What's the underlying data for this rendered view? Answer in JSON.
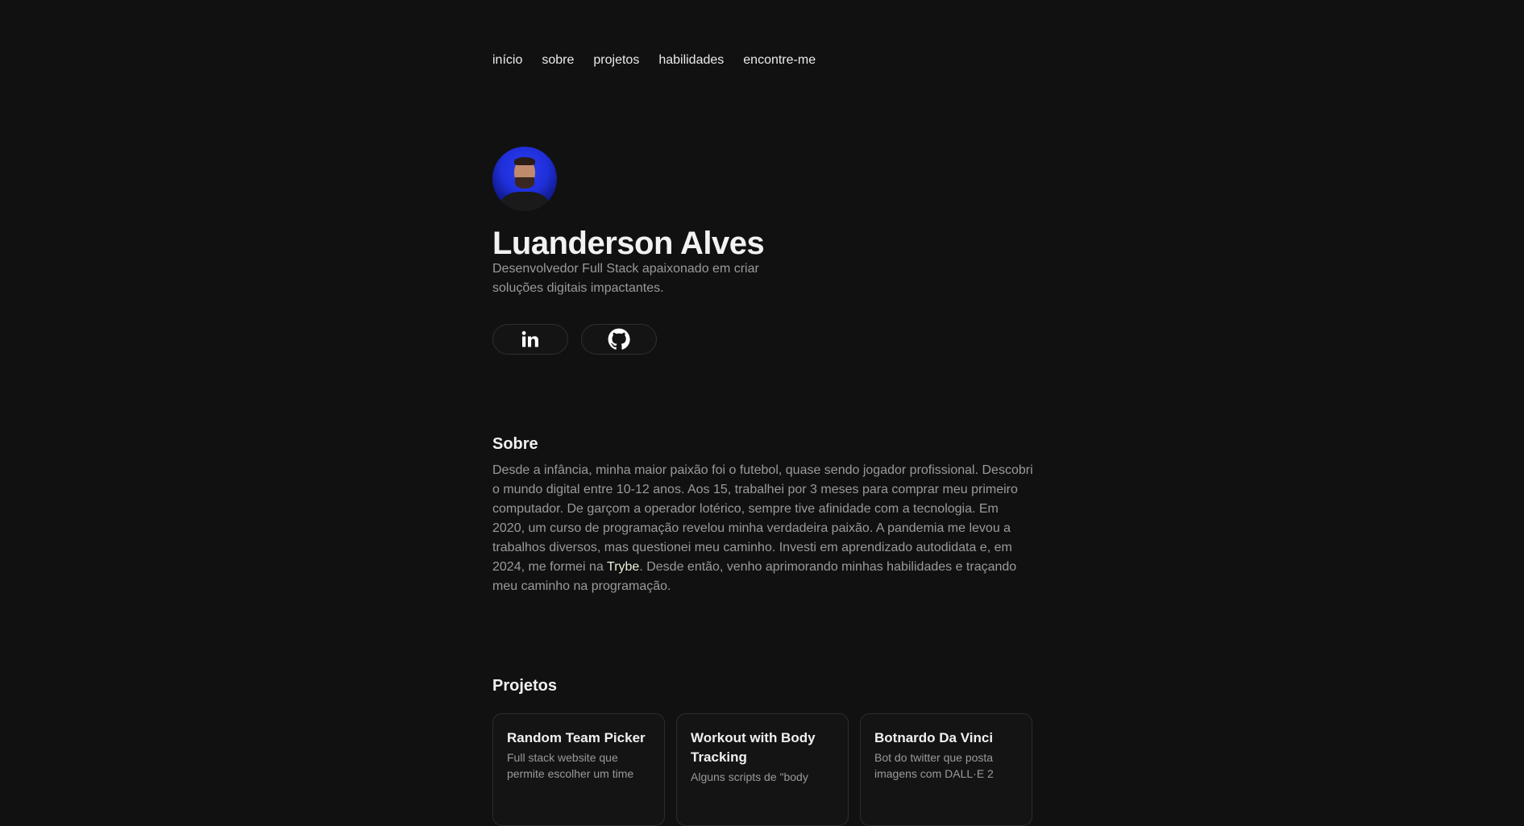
{
  "nav": {
    "items": [
      "início",
      "sobre",
      "projetos",
      "habilidades",
      "encontre-me"
    ]
  },
  "profile": {
    "name": "Luanderson Alves",
    "tagline": "Desenvolvedor Full Stack apaixonado em criar soluções digitais impactantes."
  },
  "social": {
    "linkedin_icon": "linkedin-icon",
    "github_icon": "github-icon"
  },
  "about": {
    "title": "Sobre",
    "text_before": "Desde a infância, minha maior paixão foi o futebol, quase sendo jogador profissional. Descobri o mundo digital entre 10-12 anos. Aos 15, trabalhei por 3 meses para comprar meu primeiro computador. De garçom a operador lotérico, sempre tive afinidade com a tecnologia. Em 2020, um curso de programação revelou minha verdadeira paixão. A pandemia me levou a trabalhos diversos, mas questionei meu caminho. Investi em aprendizado autodidata e, em 2024, me formei na ",
    "link_text": "Trybe",
    "text_after": ". Desde então, venho aprimorando minhas habilidades e traçando meu caminho na programação."
  },
  "projects": {
    "title": "Projetos",
    "cards": [
      {
        "title": "Random Team Picker",
        "description": "Full stack website que permite escolher um time"
      },
      {
        "title": "Workout with Body Tracking",
        "description": "Alguns scripts de \"body"
      },
      {
        "title": "Botnardo Da Vinci",
        "description": "Bot do twitter que posta imagens com DALL·E 2"
      }
    ]
  },
  "colors": {
    "background": "#111111",
    "accent_link": "#e8f3d8"
  }
}
